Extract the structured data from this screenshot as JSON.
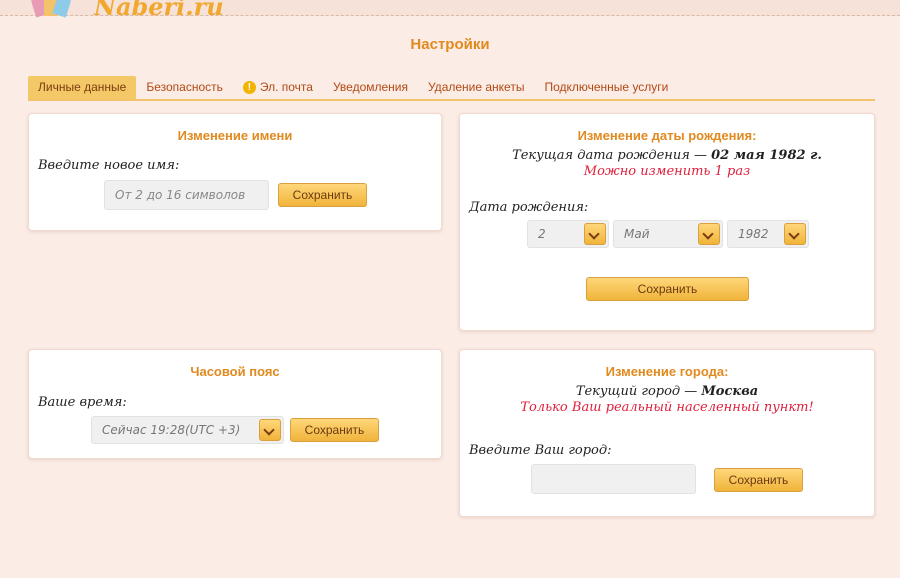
{
  "header": {
    "logo_text": "Naberi.ru"
  },
  "page_title": "Настройки",
  "tabs": [
    {
      "label": "Личные данные",
      "active": true
    },
    {
      "label": "Безопасность"
    },
    {
      "label": "Эл. почта",
      "icon": "warning-icon"
    },
    {
      "label": "Уведомления"
    },
    {
      "label": "Удаление анкеты"
    },
    {
      "label": "Подключенные услуги"
    }
  ],
  "name_card": {
    "title": "Изменение имени",
    "label": "Введите новое имя:",
    "placeholder": "От 2 до 16 символов",
    "save": "Сохранить"
  },
  "birth_card": {
    "title": "Изменение даты рождения:",
    "current_prefix": "Текущая дата рождения — ",
    "current_value": "02 мая 1982 г.",
    "note": "Можно изменить 1 раз",
    "label": "Дата рождения:",
    "day": "2",
    "month": "Май",
    "year": "1982",
    "save": "Сохранить"
  },
  "tz_card": {
    "title": "Часовой пояс",
    "label": "Ваше время:",
    "value": "Сейчас 19:28(UTC +3)",
    "save": "Сохранить"
  },
  "city_card": {
    "title": "Изменение города:",
    "current_prefix": "Текущий город — ",
    "current_value": "Москва",
    "note": "Только Ваш реальный населенный пункт!",
    "label": "Введите Ваш город:",
    "value": "",
    "save": "Сохранить"
  },
  "colors": {
    "accent": "#e08a20",
    "tab_active": "#f5c867",
    "warning": "#e0203c"
  }
}
